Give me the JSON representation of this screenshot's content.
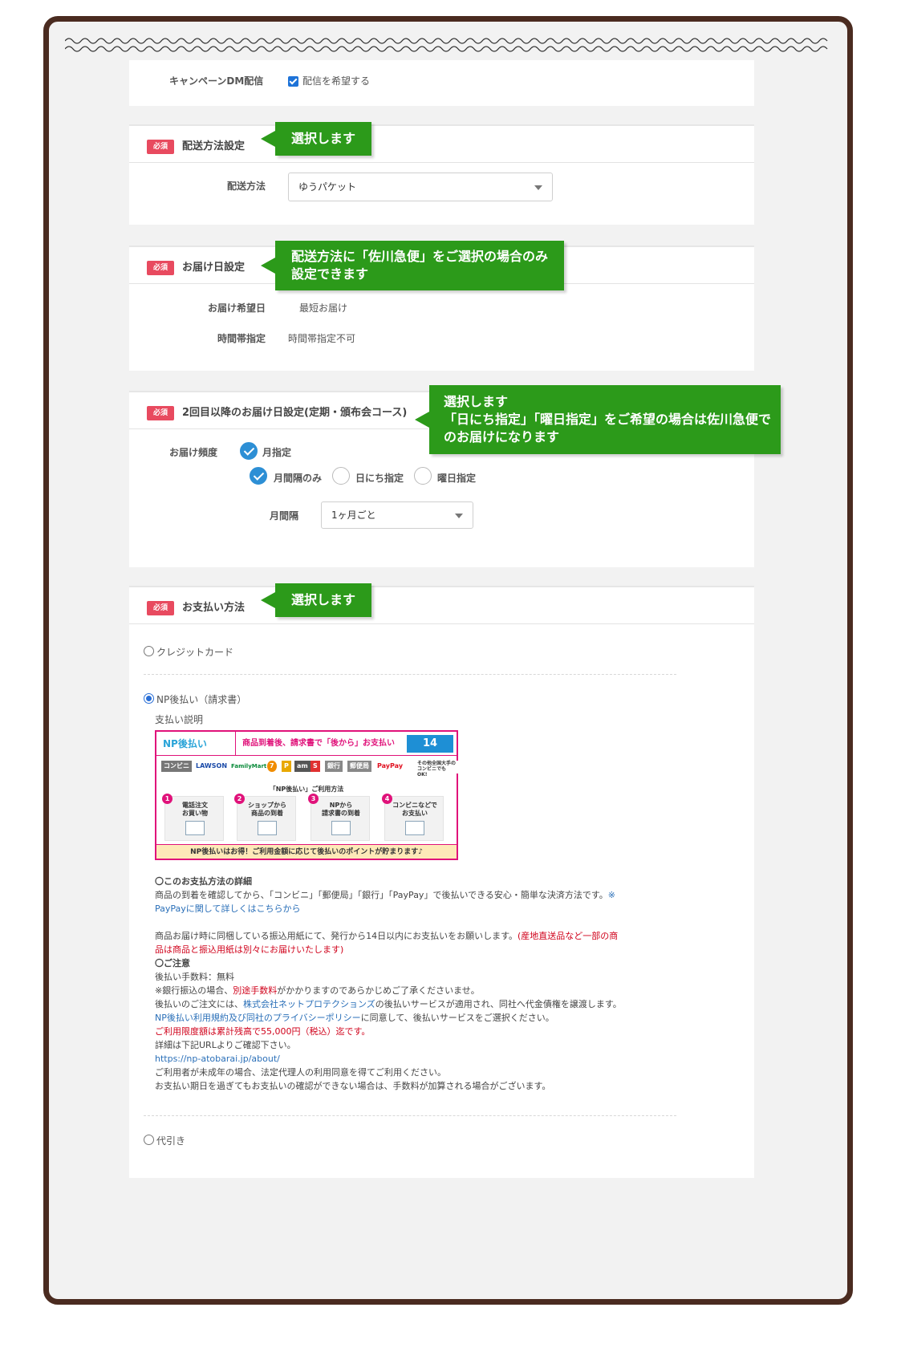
{
  "campaign": {
    "label": "キャンペーンDM配信",
    "checkbox_label": "配信を希望する",
    "checked": true
  },
  "required_badge": "必須",
  "shipping": {
    "title": "配送方法設定",
    "callout": "選択します",
    "field_label": "配送方法",
    "selected": "ゆうパケット"
  },
  "delivery_date": {
    "title": "お届け日設定",
    "callout_line1": "配送方法に「佐川急便」をご選択の場合のみ",
    "callout_line2": "設定できます",
    "desired_date_label": "お届け希望日",
    "desired_date_value": "最短お届け",
    "time_label": "時間帯指定",
    "time_value": "時間帯指定不可"
  },
  "subscription": {
    "title": "2回目以降のお届け日設定(定期・頒布会コース)",
    "callout_line1": "選択します",
    "callout_line2": "「日にち指定」「曜日指定」をご希望の場合は佐川急便で",
    "callout_line3": "のお届けになります",
    "frequency_label": "お届け頻度",
    "frequency_option": "月指定",
    "options": [
      "月間隔のみ",
      "日にち指定",
      "曜日指定"
    ],
    "selected_option": "月間隔のみ",
    "interval_label": "月間隔",
    "interval_selected": "1ヶ月ごと"
  },
  "payment": {
    "title": "お支払い方法",
    "callout": "選択します",
    "options": [
      "クレジットカード",
      "NP後払い（請求書）",
      "代引き"
    ],
    "selected": "NP後払い（請求書）",
    "description_label": "支払い説明",
    "np_banner": {
      "logo": "NP後払い",
      "headline": "商品到着後、請求書で「後から」お支払い",
      "days": "14",
      "days_note": "日以内に お支払い",
      "stores": [
        "コンビニ",
        "LAWSON",
        "FamilyMart",
        "7",
        "P",
        "am",
        "S",
        "銀行",
        "郵便局",
        "PayPay"
      ],
      "stores_note": "その他全国大手の コンビニでもOK!",
      "steps_title": "「NP後払い」ご利用方法",
      "steps": [
        {
          "num": "1",
          "text1": "電話注文",
          "text2": "お買い物"
        },
        {
          "num": "2",
          "text1": "ショップから",
          "text2": "商品の到着"
        },
        {
          "num": "3",
          "text1": "NPから",
          "text2": "請求書の到着"
        },
        {
          "num": "4",
          "text1": "コンビニなどで",
          "text2": "お支払い"
        }
      ],
      "footer": "NP後払いはお得！ご利用金額に応じて後払いのポイントが貯まります♪"
    },
    "details": {
      "heading": "〇このお支払方法の詳細",
      "line1": "商品の到着を確認してから、「コンビニ」「郵便局」「銀行」「PayPay」で後払いできる安心・簡単な決済方法です。",
      "line1_link": "※",
      "line2_link": "PayPayに関して詳しくはこちらから",
      "line3": "商品お届け時に同梱している振込用紙にて、発行から14日以内にお支払いをお願いします。",
      "line3_red": "(産地直送品など一部の商",
      "line4_red": "品は商品と振込用紙は別々にお届けいたします)",
      "caution_heading": "〇ご注意",
      "fee": "後払い手数料：無料",
      "bank_pre": "※銀行振込の場合、",
      "bank_red": "別途手数料",
      "bank_post": "がかかりますのであらかじめご了承くださいませ。",
      "company_pre": "後払いのご注文には、",
      "company_link": "株式会社ネットプロテクションズ",
      "company_post": "の後払いサービスが適用され、同社へ代金債権を譲渡します。",
      "terms_link": "NP後払い利用規約及び同社のプライバシーポリシー",
      "terms_post": "に同意して、後払いサービスをご選択ください。",
      "limit_red": "ご利用限度額は累計残高で55,000円（税込）迄です。",
      "url_intro": "詳細は下記URLよりご確認下さい。",
      "url": "https://np-atobarai.jp/about/",
      "minor": "ご利用者が未成年の場合、法定代理人の利用同意を得てご利用ください。",
      "overdue": "お支払い期日を過ぎてもお支払いの確認ができない場合は、手数料が加算される場合がございます。"
    }
  }
}
